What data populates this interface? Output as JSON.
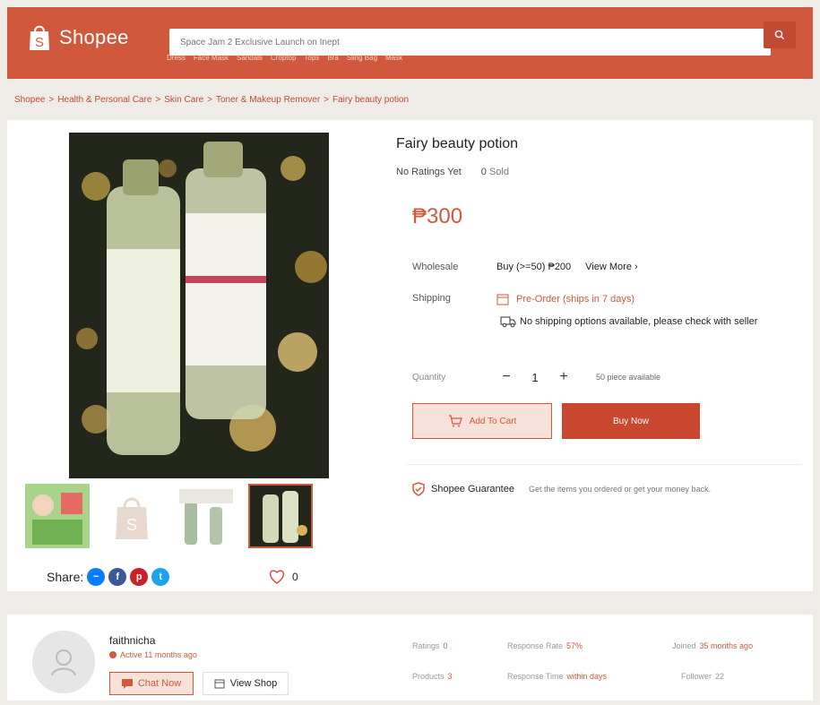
{
  "header": {
    "logo_text": "Shopee",
    "search_placeholder": "Space Jam 2 Exclusive Launch on Inept",
    "keywords": [
      "Dress",
      "Face Mask",
      "Sandals",
      "Croptop",
      "Tops",
      "Bra",
      "Sling Bag",
      "Mask"
    ]
  },
  "breadcrumb": [
    "Shopee",
    "Health & Personal Care",
    "Skin Care",
    "Toner & Makeup Remover",
    "Fairy beauty potion"
  ],
  "product": {
    "title": "Fairy beauty potion",
    "ratings": "No Ratings Yet",
    "sold_count": "0",
    "sold_label": "Sold",
    "price": "₱300",
    "wholesale_label": "Wholesale",
    "wholesale_value": "Buy (>=50) ₱200",
    "view_more": "View More",
    "shipping_label": "Shipping",
    "preorder": "Pre-Order (ships in 7 days)",
    "no_shipping": "No shipping options available, please check with seller",
    "quantity_label": "Quantity",
    "quantity": "1",
    "available": "50 piece available",
    "add_to_cart": "Add To Cart",
    "buy_now": "Buy Now",
    "guarantee_title": "Shopee Guarantee",
    "guarantee_text": "Get the items you ordered or get your money back.",
    "share_label": "Share:",
    "likes": "0"
  },
  "seller": {
    "name": "faithnicha",
    "active": "Active 11 months ago",
    "chat_now": "Chat Now",
    "view_shop": "View Shop",
    "ratings_label": "Ratings",
    "ratings": "0",
    "products_label": "Products",
    "products": "3",
    "response_rate_label": "Response Rate",
    "response_rate": "57%",
    "response_time_label": "Response Time",
    "response_time": "within days",
    "joined_label": "Joined",
    "joined": "35 months ago",
    "follower_label": "Follower",
    "follower": "22"
  },
  "colors": {
    "brand": "#d0583c",
    "brand_dark": "#c9462f"
  }
}
